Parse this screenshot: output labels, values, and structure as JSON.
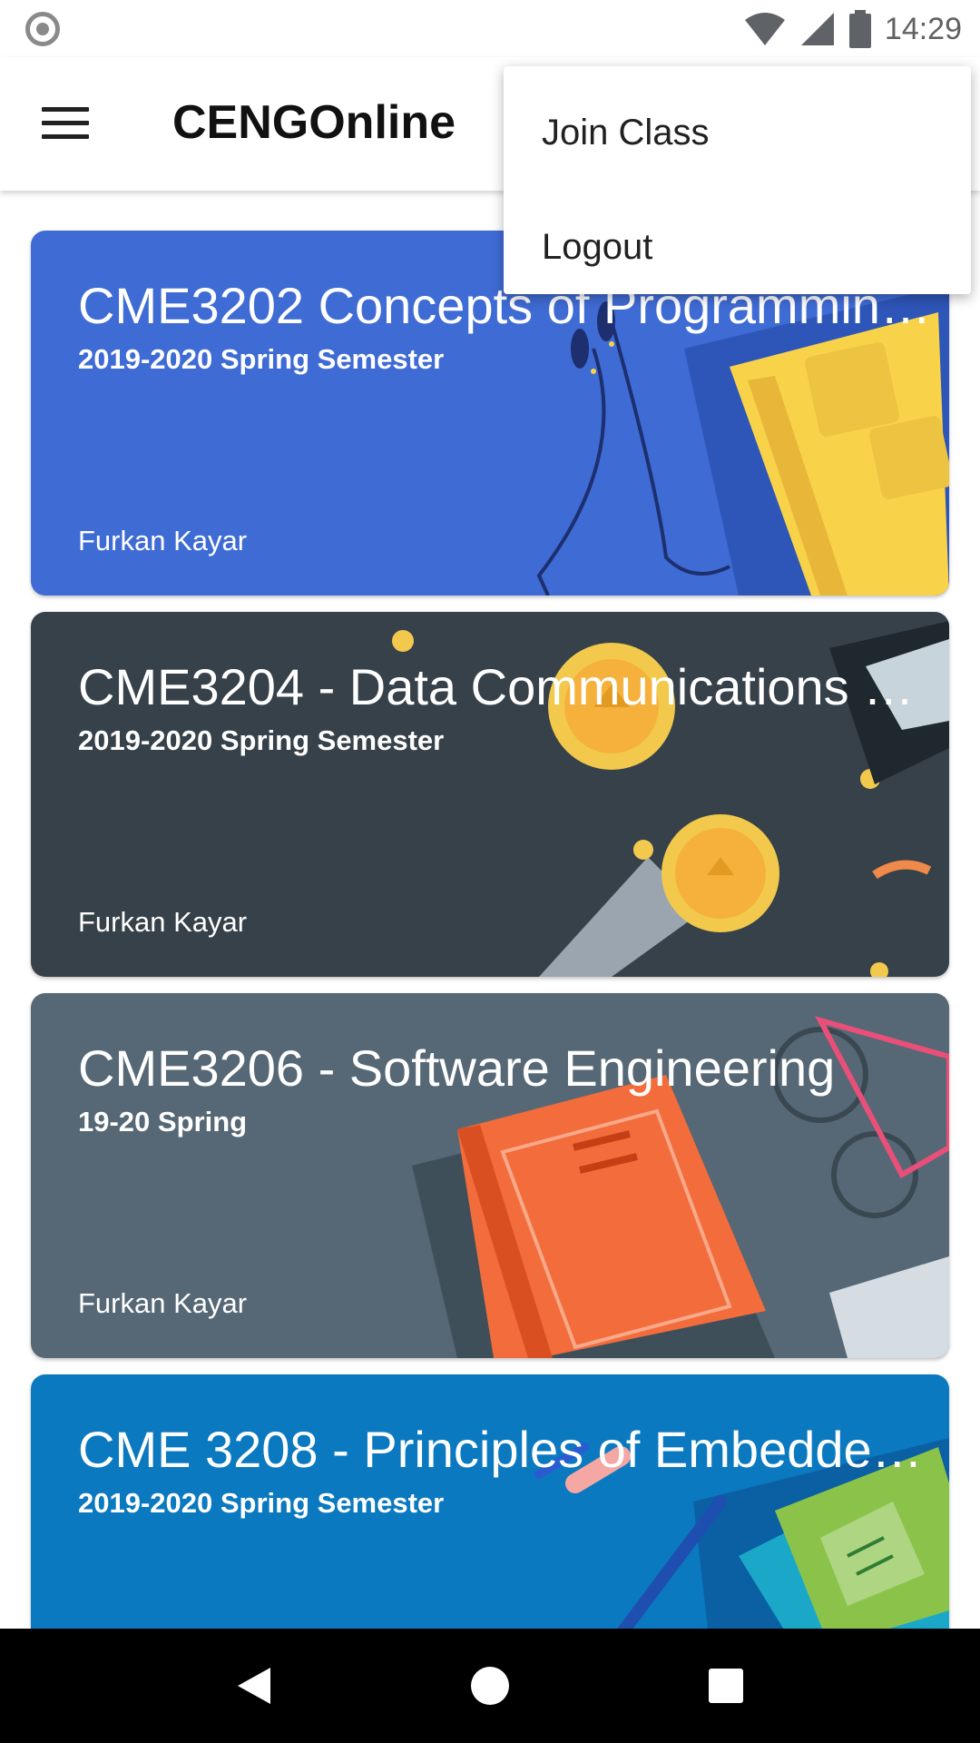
{
  "status_bar": {
    "time": "14:29",
    "icons": [
      "notification-dot-icon",
      "wifi-icon",
      "signal-icon",
      "battery-icon"
    ]
  },
  "app_bar": {
    "title": "CENGOnline",
    "menu_icon": "hamburger-menu-icon"
  },
  "overflow_menu": {
    "items": [
      {
        "label": "Join Class"
      },
      {
        "label": "Logout"
      }
    ]
  },
  "courses": [
    {
      "title": "CME3202 Concepts of Programmin…",
      "subtitle": "2019-2020 Spring Semester",
      "teacher": "Furkan Kayar",
      "color": "#3f6bd4"
    },
    {
      "title": "CME3204 - Data Communications a…",
      "subtitle": "2019-2020 Spring Semester",
      "teacher": "Furkan Kayar",
      "color": "#364149"
    },
    {
      "title": "CME3206 - Software Engineering",
      "subtitle": "19-20 Spring",
      "teacher": "Furkan Kayar",
      "color": "#566875"
    },
    {
      "title": "CME 3208 - Principles of Embedde…",
      "subtitle": "2019-2020 Spring Semester",
      "teacher": "",
      "color": "#0b79bf"
    }
  ],
  "nav_bar": {
    "icons": [
      "back-icon",
      "home-icon",
      "recents-icon"
    ]
  }
}
